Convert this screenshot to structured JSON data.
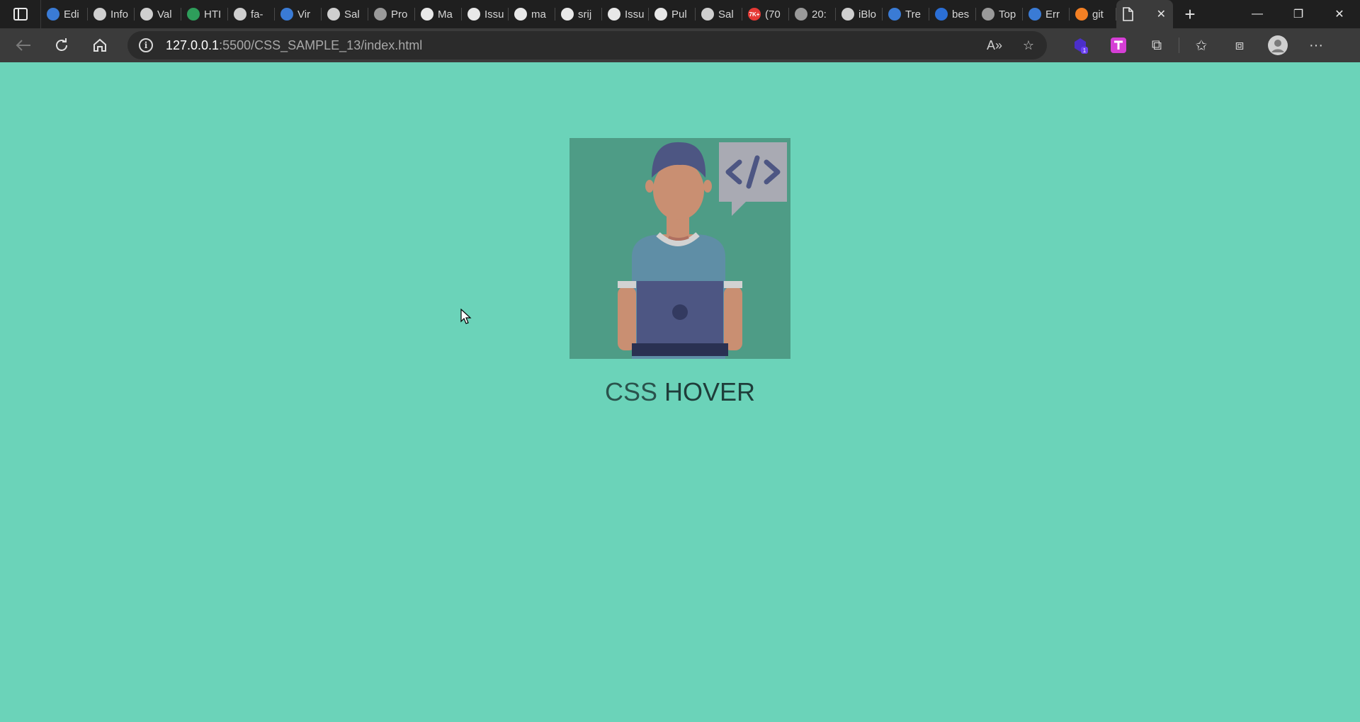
{
  "browser": {
    "tabs": [
      {
        "title": "Edi",
        "icon": "cloud-icon",
        "color": "#3a7bd5"
      },
      {
        "title": "Info",
        "icon": "page-icon",
        "color": "#cfcfcf"
      },
      {
        "title": "Val",
        "icon": "validator-icon",
        "color": "#cfcfcf"
      },
      {
        "title": "HTI",
        "icon": "w3-icon",
        "color": "#2e9e5b"
      },
      {
        "title": "fa-",
        "icon": "flag-icon",
        "color": "#cfcfcf"
      },
      {
        "title": "Vir",
        "icon": "box-icon",
        "color": "#3a7bd5"
      },
      {
        "title": "Sal",
        "icon": "page-icon",
        "color": "#cfcfcf"
      },
      {
        "title": "Pro",
        "icon": "wordpress-icon",
        "color": "#9a9a9a"
      },
      {
        "title": "Ma",
        "icon": "github-icon",
        "color": "#e8e8e8"
      },
      {
        "title": "Issu",
        "icon": "github-icon",
        "color": "#e8e8e8"
      },
      {
        "title": "ma",
        "icon": "github-icon",
        "color": "#e8e8e8"
      },
      {
        "title": "srij",
        "icon": "github-icon",
        "color": "#e8e8e8"
      },
      {
        "title": "Issu",
        "icon": "github-icon",
        "color": "#e8e8e8"
      },
      {
        "title": "Pul",
        "icon": "github-icon",
        "color": "#e8e8e8"
      },
      {
        "title": "Sal",
        "icon": "page-icon",
        "color": "#cfcfcf"
      },
      {
        "title": "(70",
        "icon": "youtube-icon",
        "color": "#e53935",
        "badge": "7K+"
      },
      {
        "title": "20:",
        "icon": "wordpress-icon",
        "color": "#9a9a9a"
      },
      {
        "title": "iBlo",
        "icon": "page-icon",
        "color": "#cfcfcf"
      },
      {
        "title": "Tre",
        "icon": "globe-icon",
        "color": "#3a7bd5"
      },
      {
        "title": "bes",
        "icon": "bing-icon",
        "color": "#2b6fd6"
      },
      {
        "title": "Top",
        "icon": "terminal-icon",
        "color": "#9a9a9a"
      },
      {
        "title": "Err",
        "icon": "search-icon",
        "color": "#3a7bd5"
      },
      {
        "title": "git",
        "icon": "stackoverflow-icon",
        "color": "#f48024"
      }
    ],
    "active_tab": {
      "title": "",
      "icon": "page-icon"
    },
    "url_host": "127.0.0.1",
    "url_rest": ":5500/CSS_SAMPLE_13/index.html",
    "extension_badge": "1"
  },
  "page": {
    "caption_light": "CSS",
    "caption_bold": "HOVER",
    "background": "#6bd3b9"
  }
}
